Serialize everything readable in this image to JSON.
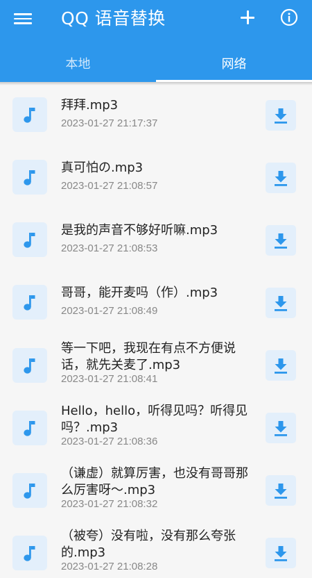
{
  "app": {
    "title": "QQ 语音替换",
    "accent": "#2d97ec"
  },
  "toolbar": {
    "menu_icon": "menu-icon",
    "add_icon": "add-icon",
    "info_icon": "info-icon"
  },
  "tabs": [
    {
      "label": "本地",
      "active": false
    },
    {
      "label": "网络",
      "active": true
    }
  ],
  "items": [
    {
      "title": "拜拜.mp3",
      "time": "2023-01-27 21:17:37"
    },
    {
      "title": "真可怕の.mp3",
      "time": "2023-01-27 21:08:57"
    },
    {
      "title": "是我的声音不够好听嘛.mp3",
      "time": "2023-01-27 21:08:53"
    },
    {
      "title": "哥哥，能开麦吗（作）.mp3",
      "time": "2023-01-27 21:08:49"
    },
    {
      "title": "等一下吧，我现在有点不方便说话，就先关麦了.mp3",
      "time": "2023-01-27 21:08:41"
    },
    {
      "title": "Hello，hello，听得见吗？听得见吗？.mp3",
      "time": "2023-01-27 21:08:36"
    },
    {
      "title": "（谦虚）就算厉害，也没有哥哥那么厉害呀～.mp3",
      "time": "2023-01-27 21:08:32"
    },
    {
      "title": "（被夸）没有啦，没有那么夸张的.mp3",
      "time": "2023-01-27 21:08:28"
    }
  ]
}
